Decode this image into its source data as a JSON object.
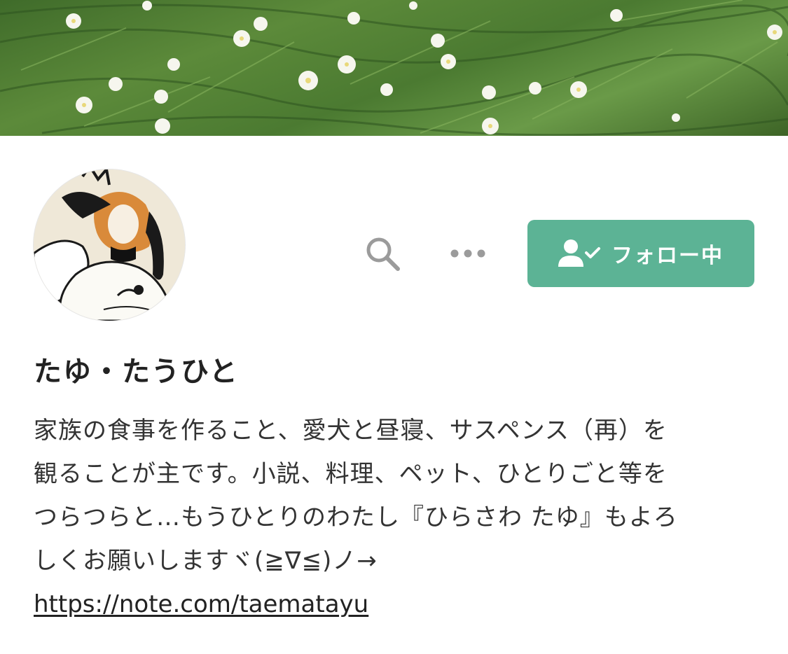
{
  "header": {
    "banner_image": "green-leaves-white-flowers-banner"
  },
  "profile": {
    "avatar_image": "illustrated-woman-portrait-avatar",
    "name": "たゆ・たうひと",
    "bio_lines": [
      "家族の食事を作ること、愛犬と昼寝、サスペンス（再）を",
      "観ることが主です。小説、料理、ペット、ひとりごと等を",
      "つらつらと…もうひとりのわたし『ひらさわ たゆ』もよろ",
      "しくお願いしますヾ(≧∇≦)ノ→"
    ],
    "link": "https://note.com/taematayu"
  },
  "actions": {
    "search_icon": "search-icon",
    "more_icon": "more-horizontal-icon",
    "follow_label": "フォロー中",
    "follow_icon": "user-check-icon"
  },
  "colors": {
    "accent": "#5cb395",
    "icon_gray": "#9b9b9b",
    "text": "#222222"
  }
}
